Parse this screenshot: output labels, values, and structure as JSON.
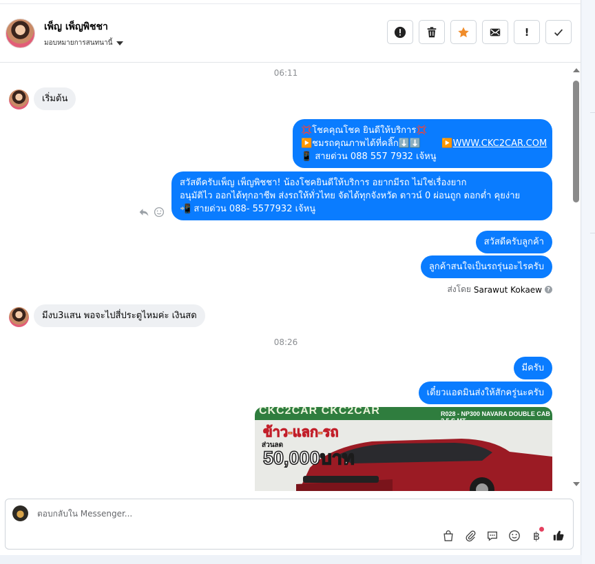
{
  "header": {
    "contact_name": "เพ็ญ เพ็ญพิชชา",
    "assign_label": "มอบหมายการสนทนานี้",
    "actions": [
      {
        "name": "mark-spam-button",
        "icon": "alert-circle-icon"
      },
      {
        "name": "delete-button",
        "icon": "trash-icon"
      },
      {
        "name": "star-button",
        "icon": "star-icon"
      },
      {
        "name": "mark-unread-button",
        "icon": "envelope-icon"
      },
      {
        "name": "follow-up-button",
        "icon": "exclamation-icon",
        "glyph": "!"
      },
      {
        "name": "mark-done-button",
        "icon": "check-icon"
      }
    ]
  },
  "chat": {
    "timestamp_1": "06:11",
    "msg_in_1": "เริ่มต้น",
    "msg_out_1": {
      "line1": "💢โชคคุณโชค ยินดีให้บริการ💢",
      "line2_text": "▶️ชมรถคุณภาพได้ที่คลิ๊ก⬇️⬇️",
      "line2_link_prefix": "▶️",
      "line2_link": "WWW.CKC2CAR.COM",
      "line3": "📱 สายด่วน 088 557 7932 เจ้หนู"
    },
    "msg_out_2": {
      "line1": "สวัสดีครับเพ็ญ เพ็ญพิชชา! น้องโชคยินดีให้บริการ อยากมีรถ ไม่ใช่เรื่องยาก",
      "line2": "อนุมัติไว ออกได้ทุกอาชีพ ส่งรถให้ทั่วไทย จัดได้ทุกจังหวัด ดาวน์ 0  ผ่อนถูก ดอกต่ำ คุยง่าย",
      "line3": "📲 สายด่วน 088- 5577932 เจ้หนู"
    },
    "msg_out_3": "สวัสดีครับลูกค้า",
    "msg_out_4": "ลูกค้าสนใจเป็นรถรุ่นอะไรครับ",
    "sent_by_prefix": "ส่งโดย",
    "sent_by_name": "Sarawut Kokaew",
    "msg_in_2": "มีงบ3แสน  พอจะไปสี่ประตูไหมค่ะ  เงินสด",
    "timestamp_2": "08:26",
    "msg_out_5": "มีครับ",
    "msg_out_6": "เดี๋ยวแอดมินส่งให้สักครู่นะครับ",
    "promo_image": {
      "banner_text": "CKC2CAR CKC2CAR",
      "model_text": "R028 - NP300 NAVARA DOUBLE CAB 2.5 S MT",
      "headline": "ข้าว-แลก-รถ",
      "sub": "ส่วนลด",
      "amount": "50,000บาท"
    }
  },
  "composer": {
    "placeholder": "ตอบกลับใน Messenger...",
    "tools": [
      "shop-bag-icon",
      "paperclip-icon",
      "saved-reply-icon",
      "emoji-icon",
      "baht-payment-icon",
      "like-icon"
    ],
    "baht_glyph": "฿"
  },
  "colors": {
    "outgoing_bubble": "#0a7cff",
    "incoming_bubble": "#eef0f3",
    "star": "#f08c2a",
    "notification_dot": "#e4405f"
  }
}
